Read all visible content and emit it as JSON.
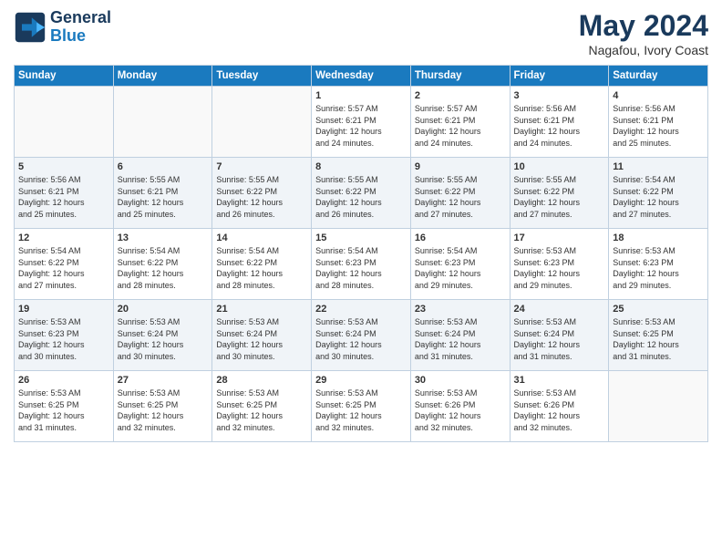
{
  "header": {
    "logo_line1": "General",
    "logo_line2": "Blue",
    "month_year": "May 2024",
    "location": "Nagafou, Ivory Coast"
  },
  "days_of_week": [
    "Sunday",
    "Monday",
    "Tuesday",
    "Wednesday",
    "Thursday",
    "Friday",
    "Saturday"
  ],
  "weeks": [
    [
      {
        "day": "",
        "info": ""
      },
      {
        "day": "",
        "info": ""
      },
      {
        "day": "",
        "info": ""
      },
      {
        "day": "1",
        "info": "Sunrise: 5:57 AM\nSunset: 6:21 PM\nDaylight: 12 hours\nand 24 minutes."
      },
      {
        "day": "2",
        "info": "Sunrise: 5:57 AM\nSunset: 6:21 PM\nDaylight: 12 hours\nand 24 minutes."
      },
      {
        "day": "3",
        "info": "Sunrise: 5:56 AM\nSunset: 6:21 PM\nDaylight: 12 hours\nand 24 minutes."
      },
      {
        "day": "4",
        "info": "Sunrise: 5:56 AM\nSunset: 6:21 PM\nDaylight: 12 hours\nand 25 minutes."
      }
    ],
    [
      {
        "day": "5",
        "info": "Sunrise: 5:56 AM\nSunset: 6:21 PM\nDaylight: 12 hours\nand 25 minutes."
      },
      {
        "day": "6",
        "info": "Sunrise: 5:55 AM\nSunset: 6:21 PM\nDaylight: 12 hours\nand 25 minutes."
      },
      {
        "day": "7",
        "info": "Sunrise: 5:55 AM\nSunset: 6:22 PM\nDaylight: 12 hours\nand 26 minutes."
      },
      {
        "day": "8",
        "info": "Sunrise: 5:55 AM\nSunset: 6:22 PM\nDaylight: 12 hours\nand 26 minutes."
      },
      {
        "day": "9",
        "info": "Sunrise: 5:55 AM\nSunset: 6:22 PM\nDaylight: 12 hours\nand 27 minutes."
      },
      {
        "day": "10",
        "info": "Sunrise: 5:55 AM\nSunset: 6:22 PM\nDaylight: 12 hours\nand 27 minutes."
      },
      {
        "day": "11",
        "info": "Sunrise: 5:54 AM\nSunset: 6:22 PM\nDaylight: 12 hours\nand 27 minutes."
      }
    ],
    [
      {
        "day": "12",
        "info": "Sunrise: 5:54 AM\nSunset: 6:22 PM\nDaylight: 12 hours\nand 27 minutes."
      },
      {
        "day": "13",
        "info": "Sunrise: 5:54 AM\nSunset: 6:22 PM\nDaylight: 12 hours\nand 28 minutes."
      },
      {
        "day": "14",
        "info": "Sunrise: 5:54 AM\nSunset: 6:22 PM\nDaylight: 12 hours\nand 28 minutes."
      },
      {
        "day": "15",
        "info": "Sunrise: 5:54 AM\nSunset: 6:23 PM\nDaylight: 12 hours\nand 28 minutes."
      },
      {
        "day": "16",
        "info": "Sunrise: 5:54 AM\nSunset: 6:23 PM\nDaylight: 12 hours\nand 29 minutes."
      },
      {
        "day": "17",
        "info": "Sunrise: 5:53 AM\nSunset: 6:23 PM\nDaylight: 12 hours\nand 29 minutes."
      },
      {
        "day": "18",
        "info": "Sunrise: 5:53 AM\nSunset: 6:23 PM\nDaylight: 12 hours\nand 29 minutes."
      }
    ],
    [
      {
        "day": "19",
        "info": "Sunrise: 5:53 AM\nSunset: 6:23 PM\nDaylight: 12 hours\nand 30 minutes."
      },
      {
        "day": "20",
        "info": "Sunrise: 5:53 AM\nSunset: 6:24 PM\nDaylight: 12 hours\nand 30 minutes."
      },
      {
        "day": "21",
        "info": "Sunrise: 5:53 AM\nSunset: 6:24 PM\nDaylight: 12 hours\nand 30 minutes."
      },
      {
        "day": "22",
        "info": "Sunrise: 5:53 AM\nSunset: 6:24 PM\nDaylight: 12 hours\nand 30 minutes."
      },
      {
        "day": "23",
        "info": "Sunrise: 5:53 AM\nSunset: 6:24 PM\nDaylight: 12 hours\nand 31 minutes."
      },
      {
        "day": "24",
        "info": "Sunrise: 5:53 AM\nSunset: 6:24 PM\nDaylight: 12 hours\nand 31 minutes."
      },
      {
        "day": "25",
        "info": "Sunrise: 5:53 AM\nSunset: 6:25 PM\nDaylight: 12 hours\nand 31 minutes."
      }
    ],
    [
      {
        "day": "26",
        "info": "Sunrise: 5:53 AM\nSunset: 6:25 PM\nDaylight: 12 hours\nand 31 minutes."
      },
      {
        "day": "27",
        "info": "Sunrise: 5:53 AM\nSunset: 6:25 PM\nDaylight: 12 hours\nand 32 minutes."
      },
      {
        "day": "28",
        "info": "Sunrise: 5:53 AM\nSunset: 6:25 PM\nDaylight: 12 hours\nand 32 minutes."
      },
      {
        "day": "29",
        "info": "Sunrise: 5:53 AM\nSunset: 6:25 PM\nDaylight: 12 hours\nand 32 minutes."
      },
      {
        "day": "30",
        "info": "Sunrise: 5:53 AM\nSunset: 6:26 PM\nDaylight: 12 hours\nand 32 minutes."
      },
      {
        "day": "31",
        "info": "Sunrise: 5:53 AM\nSunset: 6:26 PM\nDaylight: 12 hours\nand 32 minutes."
      },
      {
        "day": "",
        "info": ""
      }
    ]
  ]
}
